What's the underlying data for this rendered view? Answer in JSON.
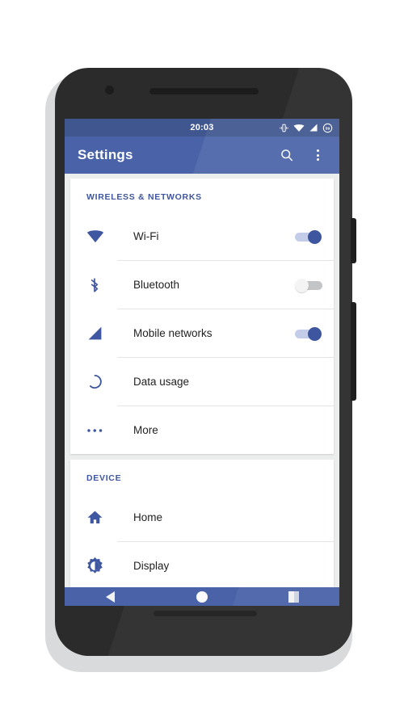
{
  "theme": {
    "toolbar_color": "#4a63a8",
    "statusbar_color": "#3f568f",
    "accent_color": "#3f56a0",
    "page_background": "#eceded",
    "card_background": "#ffffff",
    "toggle_on_track": "#c3cce8",
    "toggle_off_track": "#c3c4c6"
  },
  "status_bar": {
    "time": "20:03",
    "icons": [
      {
        "name": "vibrate-icon",
        "label": "vibrate"
      },
      {
        "name": "wifi-icon",
        "label": "wifi"
      },
      {
        "name": "signal-icon",
        "label": "cellular-signal"
      },
      {
        "name": "battery-icon",
        "label": "battery"
      }
    ],
    "battery_level": "59"
  },
  "toolbar": {
    "title": "Settings",
    "search_icon": "search-icon",
    "overflow_icon": "more-vert-icon"
  },
  "sections": [
    {
      "header": "WIRELESS & NETWORKS",
      "rows": [
        {
          "label": "Wi-Fi",
          "icon": "wifi-icon",
          "control": "toggle",
          "state": "on"
        },
        {
          "label": "Bluetooth",
          "icon": "bluetooth-icon",
          "control": "toggle",
          "state": "off"
        },
        {
          "label": "Mobile networks",
          "icon": "signal-icon",
          "control": "toggle",
          "state": "on"
        },
        {
          "label": "Data usage",
          "icon": "data-usage-icon",
          "control": "none",
          "state": ""
        },
        {
          "label": "More",
          "icon": "more-horiz-icon",
          "control": "none",
          "state": ""
        }
      ]
    },
    {
      "header": "DEVICE",
      "rows": [
        {
          "label": "Home",
          "icon": "home-icon",
          "control": "none",
          "state": ""
        },
        {
          "label": "Display",
          "icon": "brightness-icon",
          "control": "none",
          "state": ""
        }
      ]
    }
  ],
  "nav_bar": {
    "back_label": "Back",
    "home_label": "Home",
    "recent_label": "Recent apps",
    "back_icon": "back-triangle-icon",
    "home_icon": "home-circle-icon",
    "recent_icon": "recent-square-icon"
  },
  "device": {
    "camera": "front-camera",
    "speaker_top": "earpiece-speaker",
    "speaker_bottom": "bottom-speaker",
    "power_button": "power-button",
    "volume_button": "volume-rocker"
  }
}
